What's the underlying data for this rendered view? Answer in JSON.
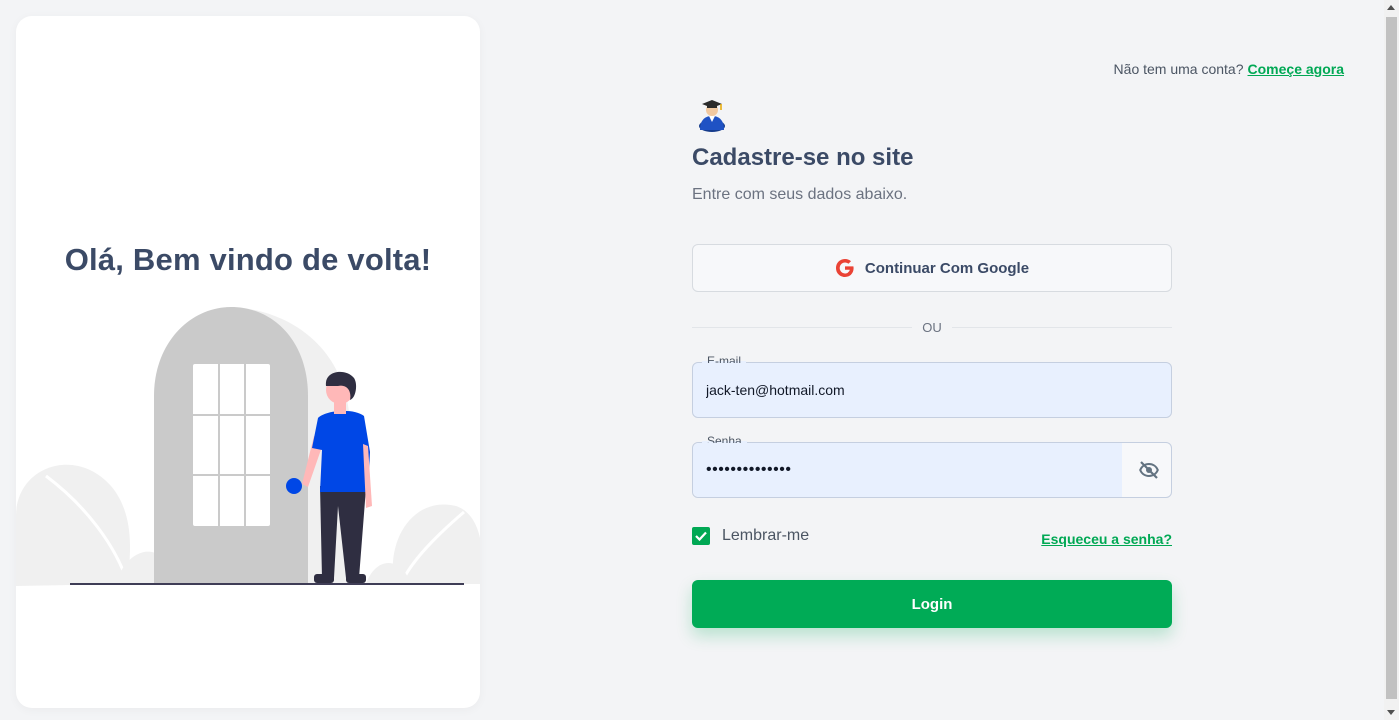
{
  "left_panel": {
    "welcome_text": "Olá, Bem vindo de volta!"
  },
  "header": {
    "prompt_text": "Não tem uma conta?",
    "signup_link": "Começe agora"
  },
  "form": {
    "title": "Cadastre-se no site",
    "subtitle": "Entre com seus dados abaixo.",
    "google_button_label": "Continuar Com Google",
    "divider_text": "OU",
    "email": {
      "label": "E-mail",
      "value": "jack-ten@hotmail.com"
    },
    "password": {
      "label": "Senha",
      "value": "••••••••••••••"
    },
    "remember_label": "Lembrar-me",
    "remember_checked": true,
    "forgot_link": "Esqueceu a senha?",
    "login_button_label": "Login"
  },
  "colors": {
    "accent_green": "#00a854",
    "heading": "#3b4a66",
    "background": "#f3f4f6",
    "input_fill": "#e8f0fe",
    "illustration_shirt": "#0047e6"
  },
  "icons": {
    "logo": "graduate-avatar-icon",
    "google": "google-g-icon",
    "password_toggle": "eye-off-icon",
    "checkbox": "check-icon"
  }
}
